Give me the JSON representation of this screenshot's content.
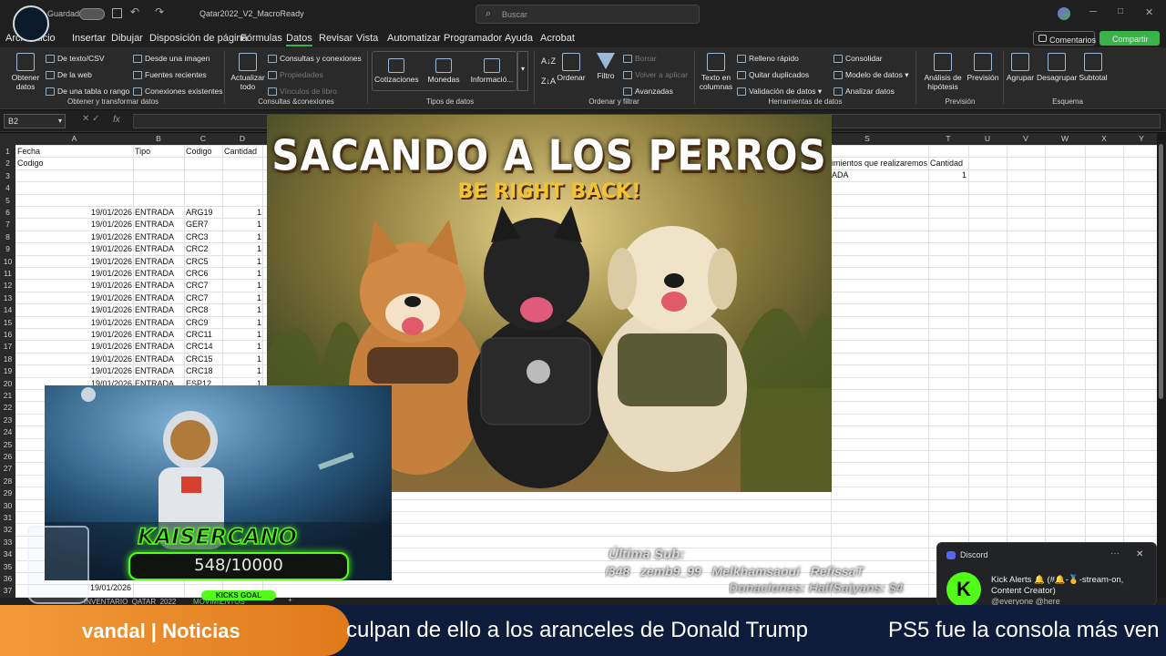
{
  "window": {
    "autosave_label": "Guardado",
    "file_title": "Qatar2022_V2_MacroReady",
    "search_placeholder": "Buscar"
  },
  "menu": [
    "Archivo",
    "Inicio",
    "Insertar",
    "Dibujar",
    "Disposición de página",
    "Fórmulas",
    "Datos",
    "Revisar",
    "Vista",
    "Automatizar",
    "Programador",
    "Ayuda",
    "Acrobat"
  ],
  "menu_active": "Datos",
  "actions": {
    "comments": "Comentarios",
    "share": "Compartir"
  },
  "ribbon": {
    "get_data": "Obtener datos",
    "text_csv": "De texto/CSV",
    "from_web": "De la web",
    "from_table": "De una tabla o rango",
    "from_image": "Desde una imagen",
    "recent_sources": "Fuentes recientes",
    "existing_conn": "Conexiones existentes",
    "group1": "Obtener y transformar datos",
    "refresh_all": "Actualizar todo",
    "queries_conn": "Consultas y conexiones",
    "properties": "Propiedades",
    "workbook_links": "Vínculos de libro",
    "group2": "Consultas &conexiones",
    "quotes": "Cotizaciones",
    "currencies": "Monedas",
    "info": "Informació...",
    "group3": "Tipos de datos",
    "sort": "Ordenar",
    "filter": "Filtro",
    "clear": "Borrar",
    "reapply": "Volver a aplicar",
    "advanced": "Avanzadas",
    "group4": "Ordenar y filtrar",
    "text_to_cols": "Texto en columnas",
    "flash_fill": "Relleno rápido",
    "remove_dup": "Quitar duplicados",
    "validation": "Validación de datos",
    "consolidate": "Consolidar",
    "data_model": "Modelo de datos",
    "analyze": "Analizar datos",
    "group5": "Herramientas de datos",
    "whatif": "Análisis de hipótesis",
    "forecast": "Previsión",
    "group6": "Previsión",
    "group_btn": "Agrupar",
    "ungroup": "Desagrupar",
    "subtotal": "Subtotal",
    "group7": "Esquema"
  },
  "namebox": "B2",
  "columns": [
    "A",
    "B",
    "C",
    "D",
    "S",
    "T",
    "U",
    "V",
    "W",
    "X",
    "Y"
  ],
  "rows": [
    "1",
    "2",
    "3",
    "4",
    "5",
    "6",
    "7",
    "8",
    "9",
    "10",
    "11",
    "12",
    "13",
    "14",
    "15",
    "16",
    "17",
    "18",
    "19",
    "20",
    "21",
    "22",
    "23",
    "24",
    "25",
    "26",
    "27",
    "28",
    "29",
    "30",
    "31",
    "32",
    "33",
    "34",
    "35",
    "36",
    "37"
  ],
  "headers": {
    "r1a": "Fecha",
    "r1b": "Tipo",
    "r1c": "Codigo",
    "r1d": "Cantidad",
    "r2a": "Codigo",
    "s2": "imientos que realizaremos",
    "t2": "Cantidad",
    "s3": "ADA",
    "t3": "1"
  },
  "data_rows": [
    {
      "date": "19/01/2026",
      "type": "ENTRADA",
      "code": "ARG19",
      "qty": "1"
    },
    {
      "date": "19/01/2026",
      "type": "ENTRADA",
      "code": "GER7",
      "qty": "1"
    },
    {
      "date": "19/01/2026",
      "type": "ENTRADA",
      "code": "CRC3",
      "qty": "1"
    },
    {
      "date": "19/01/2026",
      "type": "ENTRADA",
      "code": "CRC2",
      "qty": "1"
    },
    {
      "date": "19/01/2026",
      "type": "ENTRADA",
      "code": "CRC5",
      "qty": "1"
    },
    {
      "date": "19/01/2026",
      "type": "ENTRADA",
      "code": "CRC6",
      "qty": "1"
    },
    {
      "date": "19/01/2026",
      "type": "ENTRADA",
      "code": "CRC7",
      "qty": "1"
    },
    {
      "date": "19/01/2026",
      "type": "ENTRADA",
      "code": "CRC7",
      "qty": "1"
    },
    {
      "date": "19/01/2026",
      "type": "ENTRADA",
      "code": "CRC8",
      "qty": "1"
    },
    {
      "date": "19/01/2026",
      "type": "ENTRADA",
      "code": "CRC9",
      "qty": "1"
    },
    {
      "date": "19/01/2026",
      "type": "ENTRADA",
      "code": "CRC11",
      "qty": "1"
    },
    {
      "date": "19/01/2026",
      "type": "ENTRADA",
      "code": "CRC14",
      "qty": "1"
    },
    {
      "date": "19/01/2026",
      "type": "ENTRADA",
      "code": "CRC15",
      "qty": "1"
    },
    {
      "date": "19/01/2026",
      "type": "ENTRADA",
      "code": "CRC18",
      "qty": "1"
    },
    {
      "date": "19/01/2026",
      "type": "ENTRADA",
      "code": "ESP12",
      "qty": "1"
    }
  ],
  "row37_date": "19/01/2026",
  "sheet_tabs": [
    "INVENTARIO_QATAR_2022",
    "MOVIMIENTOS"
  ],
  "brb": {
    "title": "SACANDO A LOS PERROS",
    "subtitle": "BE RIGHT BACK!"
  },
  "cam": {
    "name": "KAISERCANO",
    "goal_count": "548/10000",
    "goal_label": "KICKS GOAL"
  },
  "stream": {
    "last_sub_label": "Última Sub:",
    "subs_line": "/348   zemb9_99   Melkhamsaoui   RefissaT",
    "donations_line": "Donaciones: HalfSaiyans: $4"
  },
  "ticker": {
    "source": "vandal | Noticias",
    "headline1": "culpan de ello a los aranceles de Donald Trump",
    "headline2": "PS5 fue la consola más ven"
  },
  "discord": {
    "app": "Discord",
    "title": "Kick Alerts 🔔 (#🔔-🥇-stream-on,",
    "line2": "Content Creator)",
    "line3": "@everyone @here"
  },
  "colors": {
    "accent_green": "#3cb34a",
    "ticker_orange": "#e8882a",
    "ticker_blue": "#0e1c3c",
    "kick_green": "#53fc18"
  }
}
